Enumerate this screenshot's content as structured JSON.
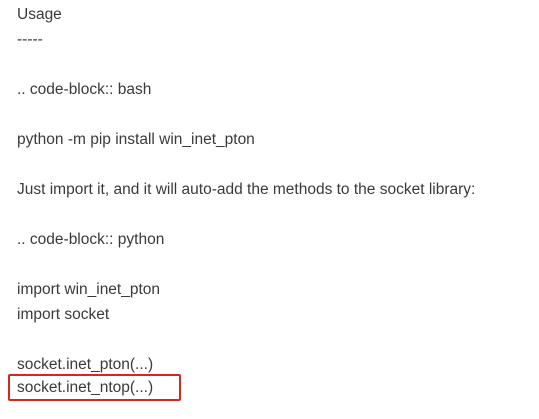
{
  "document": {
    "lines": [
      "Usage",
      "-----",
      ".. code-block:: bash",
      "python -m pip install win_inet_pton",
      "Just import it, and it will auto-add the methods to the socket library:",
      ".. code-block:: python",
      "import win_inet_pton",
      "import socket",
      "socket.inet_pton(...)",
      "socket.inet_ntop(...)"
    ],
    "highlight_color": "#d9261c",
    "text_color": "#3a3a3a"
  }
}
